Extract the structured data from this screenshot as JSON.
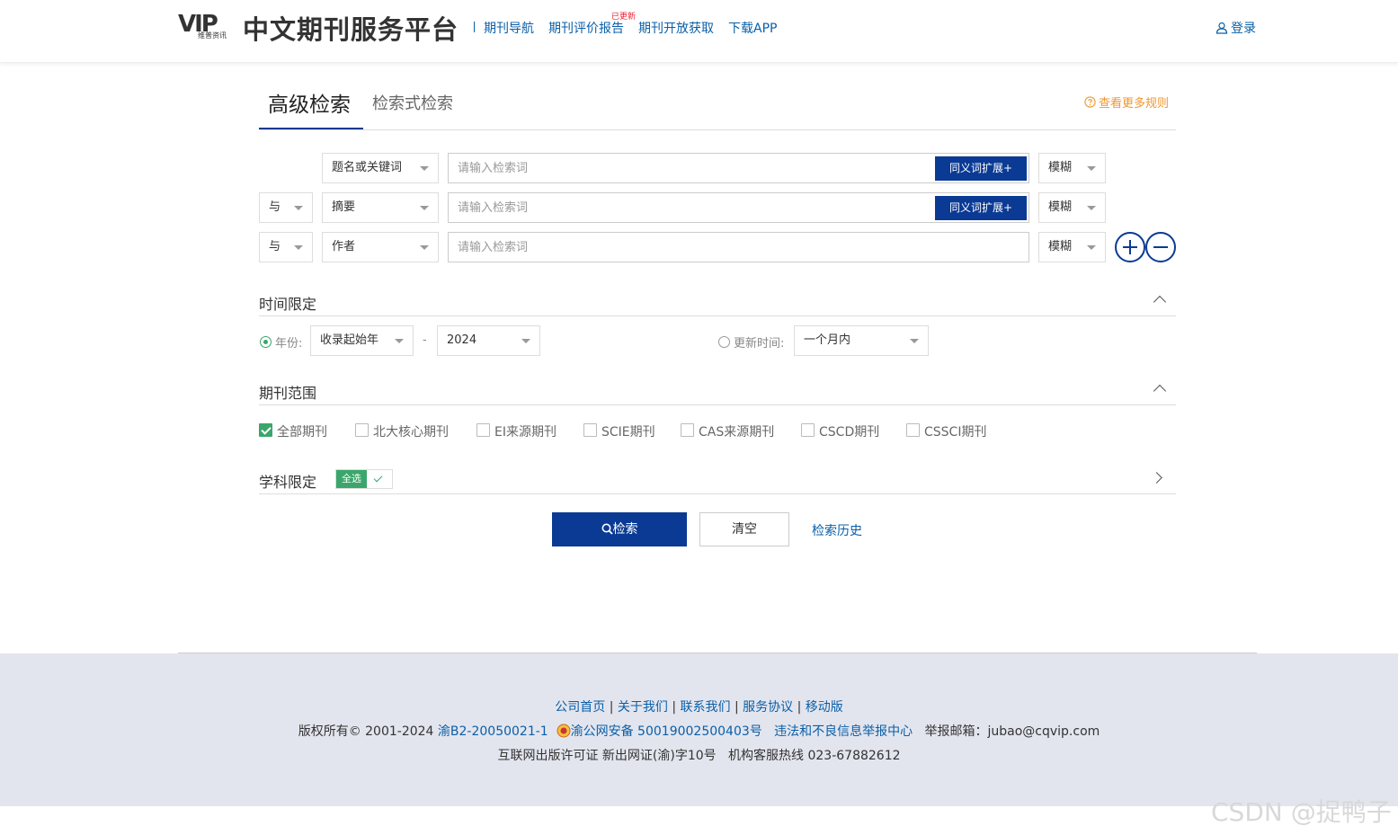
{
  "header": {
    "logo_text": "VIP",
    "logo_sub": "维普资讯",
    "title": "中文期刊服务平台",
    "nav": [
      {
        "label": "期刊导航"
      },
      {
        "label": "期刊评价报告",
        "badge": "已更新"
      },
      {
        "label": "期刊开放获取"
      },
      {
        "label": "下载APP"
      }
    ],
    "login": "登录"
  },
  "tabs": {
    "active": "高级检索",
    "other": "检索式检索",
    "rules_link": "查看更多规则"
  },
  "search_rows": [
    {
      "logic": "",
      "field": "题名或关键词",
      "placeholder": "请输入检索词",
      "synonym": "同义词扩展+",
      "match": "模糊"
    },
    {
      "logic": "与",
      "field": "摘要",
      "placeholder": "请输入检索词",
      "synonym": "同义词扩展+",
      "match": "模糊"
    },
    {
      "logic": "与",
      "field": "作者",
      "placeholder": "请输入检索词",
      "synonym": "",
      "match": "模糊"
    }
  ],
  "time": {
    "title": "时间限定",
    "year_label": "年份:",
    "year_from": "收录起始年",
    "dash": "-",
    "year_to": "2024",
    "update_label": "更新时间:",
    "update_value": "一个月内"
  },
  "scope": {
    "title": "期刊范围",
    "options": [
      {
        "label": "全部期刊",
        "checked": true
      },
      {
        "label": "北大核心期刊",
        "checked": false
      },
      {
        "label": "EI来源期刊",
        "checked": false
      },
      {
        "label": "SCIE期刊",
        "checked": false
      },
      {
        "label": "CAS来源期刊",
        "checked": false
      },
      {
        "label": "CSCD期刊",
        "checked": false
      },
      {
        "label": "CSSCI期刊",
        "checked": false
      }
    ]
  },
  "subject": {
    "title": "学科限定",
    "select_all": "全选"
  },
  "actions": {
    "search": "检索",
    "clear": "清空",
    "history": "检索历史"
  },
  "footer": {
    "links": [
      "公司首页",
      "关于我们",
      "联系我们",
      "服务协议",
      "移动版"
    ],
    "copyright": "版权所有© 2001-2024",
    "icp": "渝B2-20050021-1",
    "police": "渝公网安备 50019002500403号",
    "report_center": "违法和不良信息举报中心",
    "report_email": "举报邮箱：jubao@cqvip.com",
    "license": "互联网出版许可证 新出网证(渝)字10号",
    "hotline": "机构客服热线 023-67882612"
  },
  "watermark": "CSDN @捉鸭子",
  "colors": {
    "primary": "#0a3a94",
    "link": "#0a5fa8",
    "accent_green": "#3aa66b",
    "rules_orange": "#f0962f",
    "footer_bg": "#e3e5ee"
  }
}
